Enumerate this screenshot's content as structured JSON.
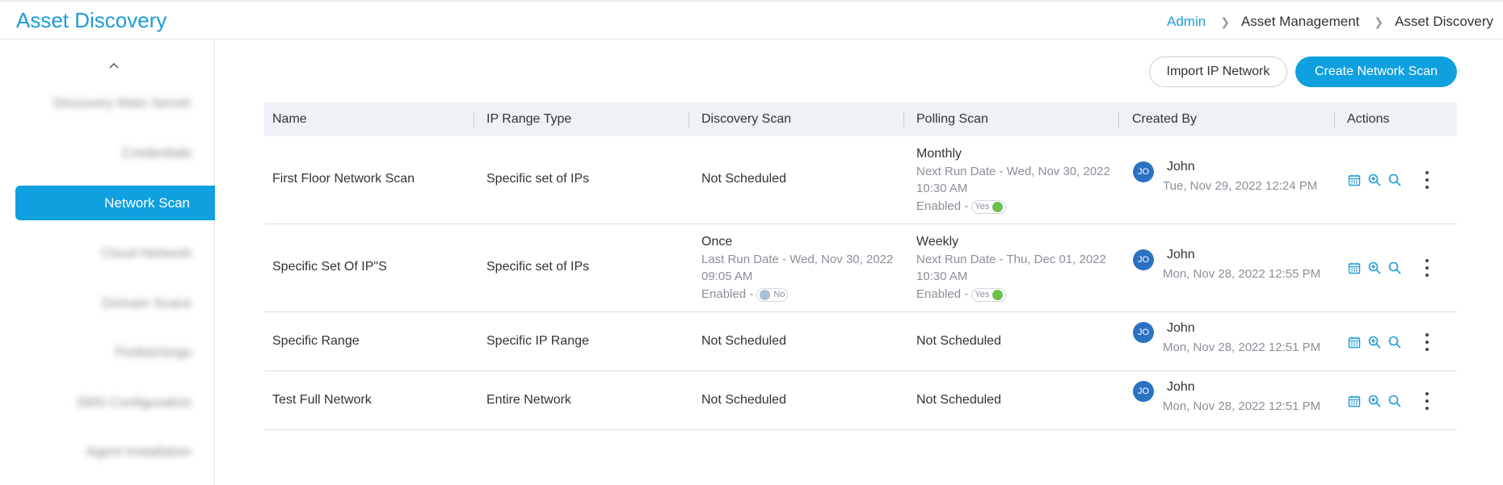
{
  "header": {
    "title": "Asset Discovery",
    "breadcrumb": [
      "Admin",
      "Asset Management",
      "Asset Discovery"
    ]
  },
  "sidebar": {
    "active_item": "Network Scan",
    "blurred_items": [
      "Discovery Main Server",
      "Credentials",
      "Cloud Network",
      "Domain Scans",
      "Prefetchings",
      "SMS Configuration",
      "Agent Installation"
    ]
  },
  "toolbar": {
    "import_label": "Import IP Network",
    "create_label": "Create Network Scan"
  },
  "table": {
    "columns": [
      "Name",
      "IP Range Type",
      "Discovery Scan",
      "Polling Scan",
      "Created By",
      "Actions"
    ],
    "rows": [
      {
        "name": "First Floor Network Scan",
        "ip_range_type": "Specific set of IPs",
        "discovery": {
          "main": "Not Scheduled"
        },
        "polling": {
          "main": "Monthly",
          "line1": "Next Run Date - Wed, Nov 30, 2022",
          "line2": "10:30 AM",
          "enabled_label": "Enabled -",
          "toggle": "Yes"
        },
        "avatar": "JO",
        "creator": "John",
        "created_at": "Tue, Nov 29, 2022 12:24 PM"
      },
      {
        "name": "Specific Set Of IP\"S",
        "ip_range_type": "Specific set of IPs",
        "discovery": {
          "main": "Once",
          "line1": "Last Run Date - Wed, Nov 30, 2022",
          "line2": "09:05 AM",
          "enabled_label": "Enabled -",
          "toggle": "No"
        },
        "polling": {
          "main": "Weekly",
          "line1": "Next Run Date - Thu, Dec 01, 2022",
          "line2": "10:30 AM",
          "enabled_label": "Enabled -",
          "toggle": "Yes"
        },
        "avatar": "JO",
        "creator": "John",
        "created_at": "Mon, Nov 28, 2022 12:55 PM"
      },
      {
        "name": "Specific Range",
        "ip_range_type": "Specific IP Range",
        "discovery": {
          "main": "Not Scheduled"
        },
        "polling": {
          "main": "Not Scheduled"
        },
        "avatar": "JO",
        "creator": "John",
        "created_at": "Mon, Nov 28, 2022 12:51 PM"
      },
      {
        "name": "Test Full Network",
        "ip_range_type": "Entire Network",
        "discovery": {
          "main": "Not Scheduled"
        },
        "polling": {
          "main": "Not Scheduled"
        },
        "avatar": "JO",
        "creator": "John",
        "created_at": "Mon, Nov 28, 2022 12:51 PM"
      }
    ]
  },
  "icons": {
    "action_icons": [
      "calendar-icon",
      "zoom-in-icon",
      "search-icon",
      "kebab-menu-icon"
    ],
    "accent_color": "#0fa0e0",
    "toggle_on_color": "#6cc04a"
  }
}
